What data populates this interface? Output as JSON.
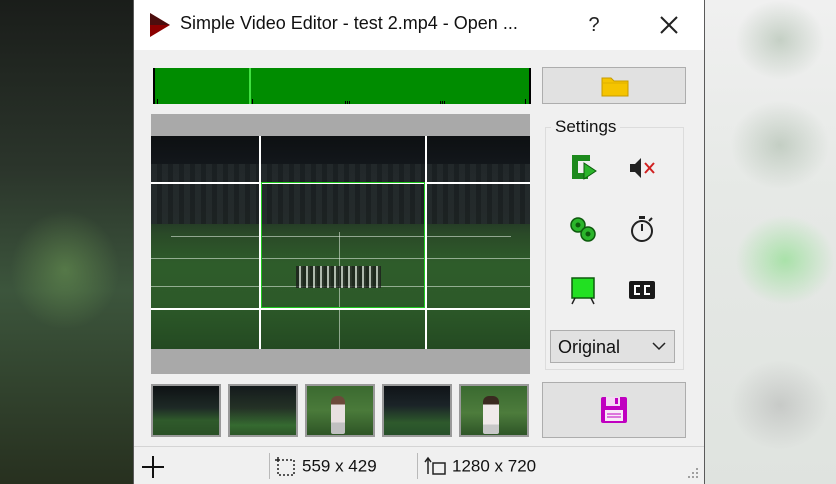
{
  "window": {
    "title": "Simple Video Editor - test 2.mp4 - Open ...",
    "help_label": "?"
  },
  "timeline": {
    "playhead_fraction": 0.25,
    "fill_color": "#008c00",
    "playhead_color": "#40e040"
  },
  "toolbar": {
    "open_icon": "folder-icon",
    "save_icon": "floppy-disk-icon"
  },
  "settings": {
    "group_label": "Settings",
    "tools": [
      {
        "name": "rotate-icon"
      },
      {
        "name": "mute-icon"
      },
      {
        "name": "convert-icon"
      },
      {
        "name": "timer-icon"
      },
      {
        "name": "crop-frame-icon"
      },
      {
        "name": "subtitles-icon"
      }
    ],
    "quality": {
      "selected": "Original"
    }
  },
  "thumbnails": [
    {
      "name": "thumbnail-1"
    },
    {
      "name": "thumbnail-2"
    },
    {
      "name": "thumbnail-3"
    },
    {
      "name": "thumbnail-4"
    },
    {
      "name": "thumbnail-5"
    }
  ],
  "status": {
    "selection_size": "559 x 429",
    "video_resolution": "1280 x 720"
  },
  "colors": {
    "accent_green": "#008c00",
    "save_purple": "#c000c0",
    "folder_yellow": "#f5c400"
  }
}
